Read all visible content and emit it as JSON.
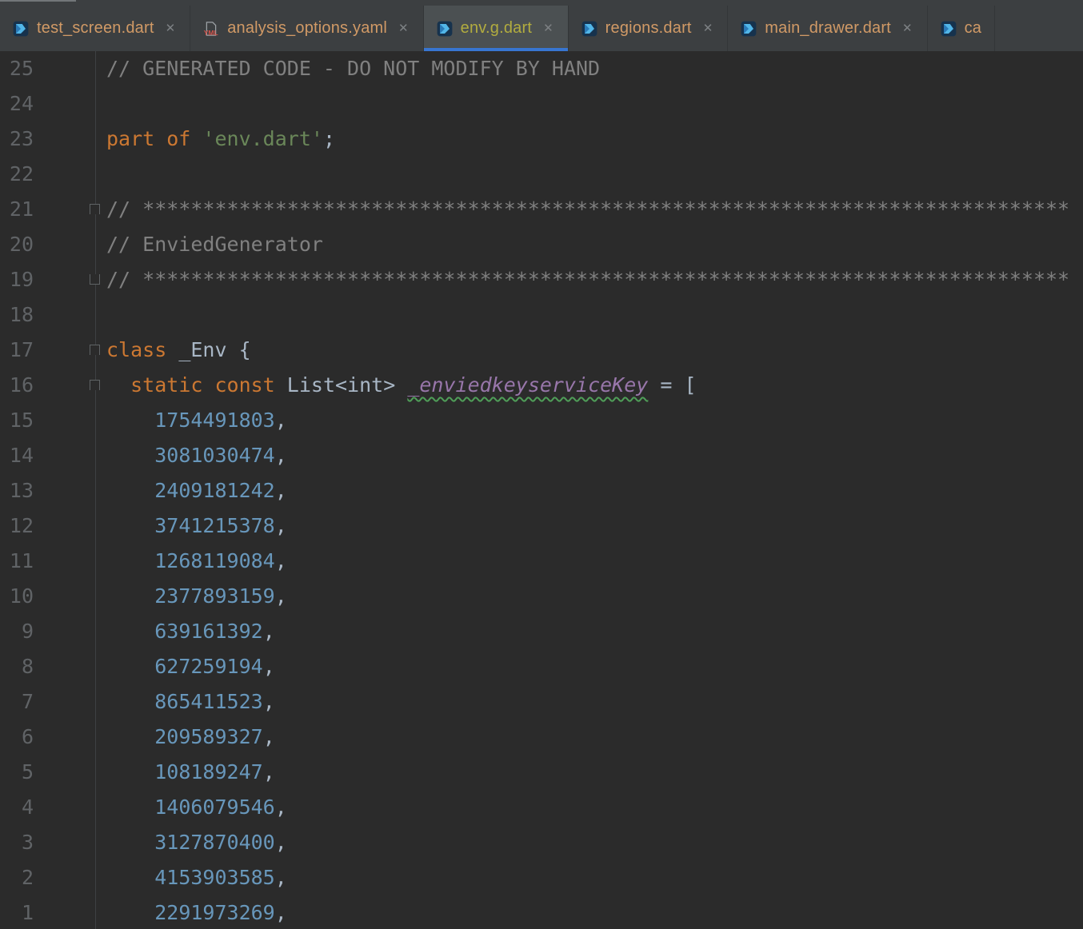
{
  "icons": {
    "close": "✕",
    "dart_file": "dart-file-icon",
    "yaml_file": "yaml-file-icon"
  },
  "colors": {
    "editor_background": "#2B2B2B",
    "tab_bar_background": "#3C3F41",
    "active_tab_background": "#4B5052",
    "active_tab_underline": "#3876D1",
    "tab_text_unversioned": "#D19A66",
    "tab_text_ignored": "#B2AC3F",
    "line_number": "#606366",
    "comment": "#808080",
    "keyword": "#CC7832",
    "string": "#6A8759",
    "number": "#6897BB",
    "plain_text": "#A9B7C6",
    "field_identifier": "#9876AA",
    "typo_squiggle": "#4F9E58"
  },
  "tab_bar": {
    "tabs": [
      {
        "label": "test_screen.dart",
        "icon": "dart-file-icon",
        "active": false,
        "color_role": "unversioned"
      },
      {
        "label": "analysis_options.yaml",
        "icon": "yaml-file-icon",
        "active": false,
        "color_role": "unversioned"
      },
      {
        "label": "env.g.dart",
        "icon": "dart-file-icon",
        "active": true,
        "color_role": "ignored"
      },
      {
        "label": "regions.dart",
        "icon": "dart-file-icon",
        "active": false,
        "color_role": "unversioned"
      },
      {
        "label": "main_drawer.dart",
        "icon": "dart-file-icon",
        "active": false,
        "color_role": "unversioned"
      },
      {
        "label": "ca",
        "icon": "dart-file-icon",
        "active": false,
        "color_role": "unversioned",
        "clipped": true
      }
    ]
  },
  "editor": {
    "active_file": "env.g.dart",
    "lines": [
      {
        "num": 25,
        "tokens": [
          {
            "c": "comment",
            "t": "// GENERATED CODE - DO NOT MODIFY BY HAND"
          }
        ]
      },
      {
        "num": 24,
        "tokens": []
      },
      {
        "num": 23,
        "tokens": [
          {
            "c": "kw",
            "t": "part of "
          },
          {
            "c": "str",
            "t": "'env.dart'"
          },
          {
            "c": "plain",
            "t": ";"
          }
        ]
      },
      {
        "num": 22,
        "tokens": []
      },
      {
        "num": 21,
        "fold": "start",
        "tokens": [
          {
            "c": "comment",
            "t": "// *****************************************************************************"
          }
        ]
      },
      {
        "num": 20,
        "tokens": [
          {
            "c": "comment",
            "t": "// EnviedGenerator"
          }
        ]
      },
      {
        "num": 19,
        "fold": "end",
        "tokens": [
          {
            "c": "comment",
            "t": "// *****************************************************************************"
          }
        ]
      },
      {
        "num": 18,
        "tokens": []
      },
      {
        "num": 17,
        "fold": "start",
        "tokens": [
          {
            "c": "kw",
            "t": "class"
          },
          {
            "c": "plain",
            "t": " _Env {"
          }
        ]
      },
      {
        "num": 16,
        "fold": "start",
        "tokens": [
          {
            "c": "plain",
            "t": "  "
          },
          {
            "c": "kw",
            "t": "static const"
          },
          {
            "c": "plain",
            "t": " List<int> "
          },
          {
            "c": "field",
            "t": "_enviedkeyserviceKey"
          },
          {
            "c": "plain",
            "t": " = ["
          }
        ]
      },
      {
        "num": 15,
        "tokens": [
          {
            "c": "plain",
            "t": "    "
          },
          {
            "c": "num",
            "t": "1754491803"
          },
          {
            "c": "plain",
            "t": ","
          }
        ]
      },
      {
        "num": 14,
        "tokens": [
          {
            "c": "plain",
            "t": "    "
          },
          {
            "c": "num",
            "t": "3081030474"
          },
          {
            "c": "plain",
            "t": ","
          }
        ]
      },
      {
        "num": 13,
        "tokens": [
          {
            "c": "plain",
            "t": "    "
          },
          {
            "c": "num",
            "t": "2409181242"
          },
          {
            "c": "plain",
            "t": ","
          }
        ]
      },
      {
        "num": 12,
        "tokens": [
          {
            "c": "plain",
            "t": "    "
          },
          {
            "c": "num",
            "t": "3741215378"
          },
          {
            "c": "plain",
            "t": ","
          }
        ]
      },
      {
        "num": 11,
        "tokens": [
          {
            "c": "plain",
            "t": "    "
          },
          {
            "c": "num",
            "t": "1268119084"
          },
          {
            "c": "plain",
            "t": ","
          }
        ]
      },
      {
        "num": 10,
        "tokens": [
          {
            "c": "plain",
            "t": "    "
          },
          {
            "c": "num",
            "t": "2377893159"
          },
          {
            "c": "plain",
            "t": ","
          }
        ]
      },
      {
        "num": 9,
        "tokens": [
          {
            "c": "plain",
            "t": "    "
          },
          {
            "c": "num",
            "t": "639161392"
          },
          {
            "c": "plain",
            "t": ","
          }
        ]
      },
      {
        "num": 8,
        "tokens": [
          {
            "c": "plain",
            "t": "    "
          },
          {
            "c": "num",
            "t": "627259194"
          },
          {
            "c": "plain",
            "t": ","
          }
        ]
      },
      {
        "num": 7,
        "tokens": [
          {
            "c": "plain",
            "t": "    "
          },
          {
            "c": "num",
            "t": "865411523"
          },
          {
            "c": "plain",
            "t": ","
          }
        ]
      },
      {
        "num": 6,
        "tokens": [
          {
            "c": "plain",
            "t": "    "
          },
          {
            "c": "num",
            "t": "209589327"
          },
          {
            "c": "plain",
            "t": ","
          }
        ]
      },
      {
        "num": 5,
        "tokens": [
          {
            "c": "plain",
            "t": "    "
          },
          {
            "c": "num",
            "t": "108189247"
          },
          {
            "c": "plain",
            "t": ","
          }
        ]
      },
      {
        "num": 4,
        "tokens": [
          {
            "c": "plain",
            "t": "    "
          },
          {
            "c": "num",
            "t": "1406079546"
          },
          {
            "c": "plain",
            "t": ","
          }
        ]
      },
      {
        "num": 3,
        "tokens": [
          {
            "c": "plain",
            "t": "    "
          },
          {
            "c": "num",
            "t": "3127870400"
          },
          {
            "c": "plain",
            "t": ","
          }
        ]
      },
      {
        "num": 2,
        "tokens": [
          {
            "c": "plain",
            "t": "    "
          },
          {
            "c": "num",
            "t": "4153903585"
          },
          {
            "c": "plain",
            "t": ","
          }
        ]
      },
      {
        "num": 1,
        "tokens": [
          {
            "c": "plain",
            "t": "    "
          },
          {
            "c": "num",
            "t": "2291973269"
          },
          {
            "c": "plain",
            "t": ","
          }
        ]
      }
    ]
  }
}
